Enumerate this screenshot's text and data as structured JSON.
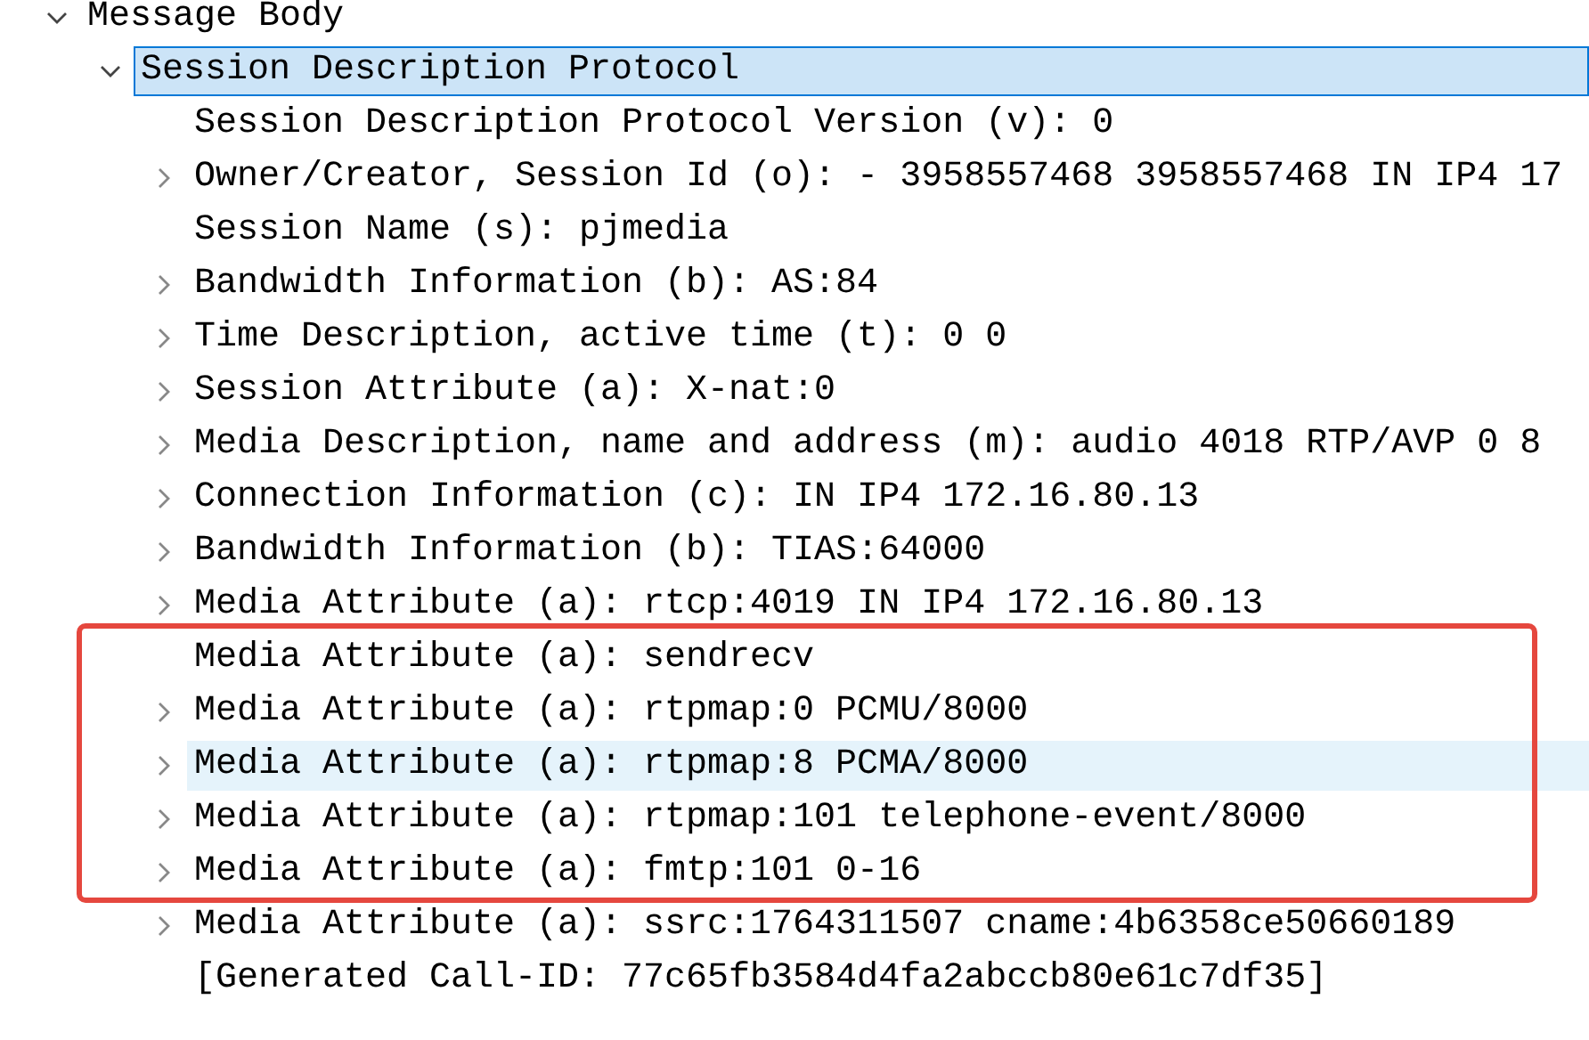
{
  "tree": [
    {
      "label": "Message Body",
      "kind": "branch",
      "expanded": true,
      "selected": false,
      "hovered": false,
      "children": [
        {
          "label": "Session Description Protocol",
          "kind": "branch",
          "expanded": true,
          "selected": true,
          "hovered": false,
          "children": [
            {
              "label": "Session Description Protocol Version (v): 0",
              "kind": "leaf",
              "selected": false,
              "hovered": false
            },
            {
              "label": "Owner/Creator, Session Id (o): - 3958557468 3958557468 IN IP4 17",
              "kind": "branch",
              "expanded": false,
              "selected": false,
              "hovered": false
            },
            {
              "label": "Session Name (s): pjmedia",
              "kind": "leaf",
              "selected": false,
              "hovered": false
            },
            {
              "label": "Bandwidth Information (b): AS:84",
              "kind": "branch",
              "expanded": false,
              "selected": false,
              "hovered": false
            },
            {
              "label": "Time Description, active time (t): 0 0",
              "kind": "branch",
              "expanded": false,
              "selected": false,
              "hovered": false
            },
            {
              "label": "Session Attribute (a): X-nat:0",
              "kind": "branch",
              "expanded": false,
              "selected": false,
              "hovered": false
            },
            {
              "label": "Media Description, name and address (m): audio 4018 RTP/AVP 0 8",
              "kind": "branch",
              "expanded": false,
              "selected": false,
              "hovered": false
            },
            {
              "label": "Connection Information (c): IN IP4 172.16.80.13",
              "kind": "branch",
              "expanded": false,
              "selected": false,
              "hovered": false
            },
            {
              "label": "Bandwidth Information (b): TIAS:64000",
              "kind": "branch",
              "expanded": false,
              "selected": false,
              "hovered": false
            },
            {
              "label": "Media Attribute (a): rtcp:4019 IN IP4 172.16.80.13",
              "kind": "branch",
              "expanded": false,
              "selected": false,
              "hovered": false
            },
            {
              "label": "Media Attribute (a): sendrecv",
              "kind": "leaf",
              "selected": false,
              "hovered": false
            },
            {
              "label": "Media Attribute (a): rtpmap:0 PCMU/8000",
              "kind": "branch",
              "expanded": false,
              "selected": false,
              "hovered": false
            },
            {
              "label": "Media Attribute (a): rtpmap:8 PCMA/8000",
              "kind": "branch",
              "expanded": false,
              "selected": false,
              "hovered": true
            },
            {
              "label": "Media Attribute (a): rtpmap:101 telephone-event/8000",
              "kind": "branch",
              "expanded": false,
              "selected": false,
              "hovered": false
            },
            {
              "label": "Media Attribute (a): fmtp:101 0-16",
              "kind": "branch",
              "expanded": false,
              "selected": false,
              "hovered": false
            },
            {
              "label": "Media Attribute (a): ssrc:1764311507 cname:4b6358ce50660189",
              "kind": "branch",
              "expanded": false,
              "selected": false,
              "hovered": false
            },
            {
              "label": "[Generated Call-ID: 77c65fb3584d4fa2abccb80e61c7df35]",
              "kind": "leaf",
              "selected": false,
              "hovered": false
            }
          ]
        }
      ]
    }
  ],
  "annotation": {
    "kind": "rectangle"
  }
}
